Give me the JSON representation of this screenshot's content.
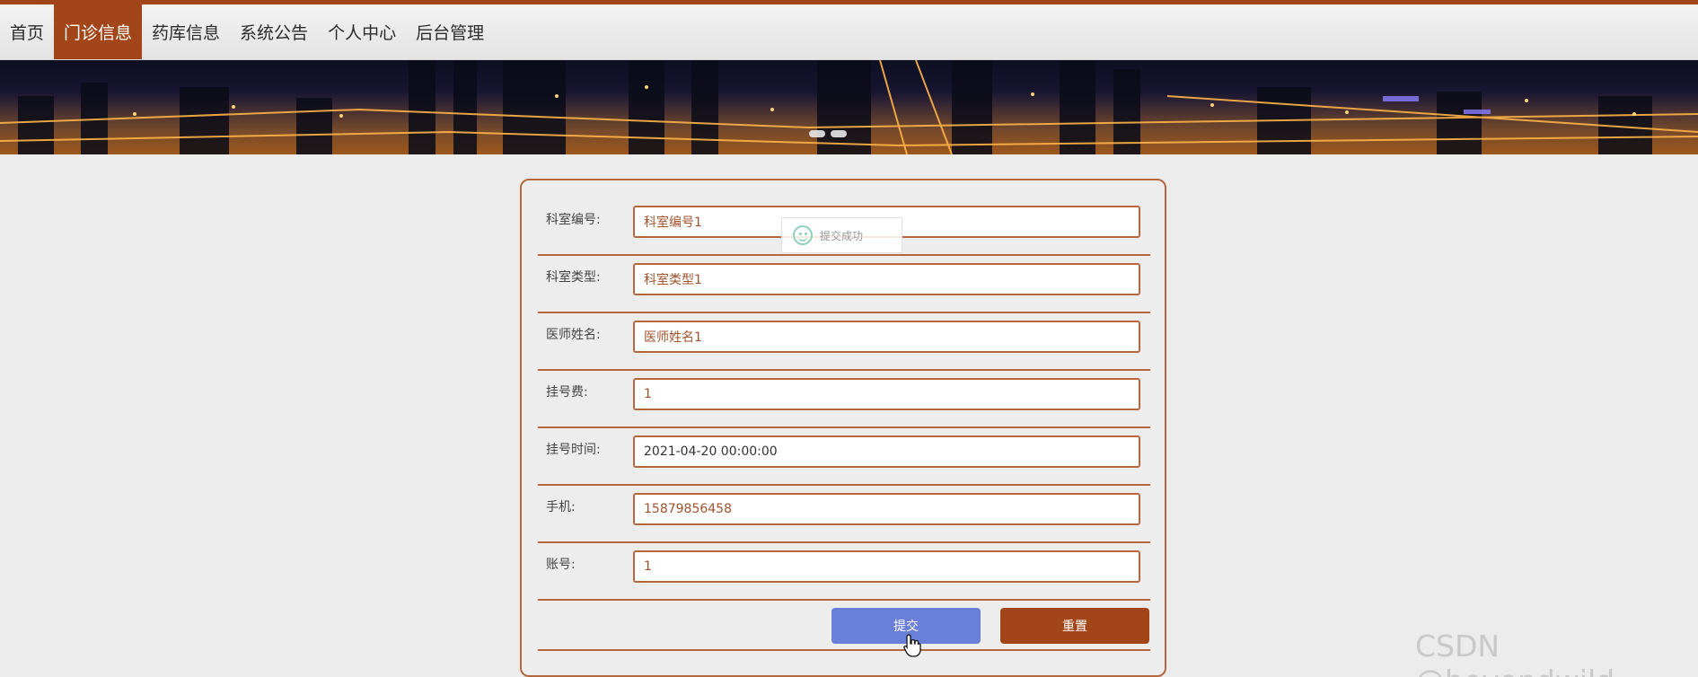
{
  "nav": {
    "items": [
      {
        "label": "首页",
        "active": false
      },
      {
        "label": "门诊信息",
        "active": true
      },
      {
        "label": "药库信息",
        "active": false
      },
      {
        "label": "系统公告",
        "active": false
      },
      {
        "label": "个人中心",
        "active": false
      },
      {
        "label": "后台管理",
        "active": false
      }
    ]
  },
  "banner": {
    "icon": "city-night-banner"
  },
  "form": {
    "fields": [
      {
        "label": "科室编号:",
        "value": "科室编号1"
      },
      {
        "label": "科室类型:",
        "value": "科室类型1"
      },
      {
        "label": "医师姓名:",
        "value": "医师姓名1"
      },
      {
        "label": "挂号费:",
        "value": "1"
      },
      {
        "label": "挂号时间:",
        "value": "2021-04-20 00:00:00"
      },
      {
        "label": "手机:",
        "value": "15879856458"
      },
      {
        "label": "账号:",
        "value": "1"
      }
    ],
    "submit_label": "提交",
    "reset_label": "重置"
  },
  "toast": {
    "message": "提交成功",
    "icon": "smile-icon"
  },
  "watermark": "CSDN @beyondwild",
  "colors": {
    "accent": "#a2461a",
    "submit": "#6a7fd7",
    "border": "#b5683e"
  }
}
